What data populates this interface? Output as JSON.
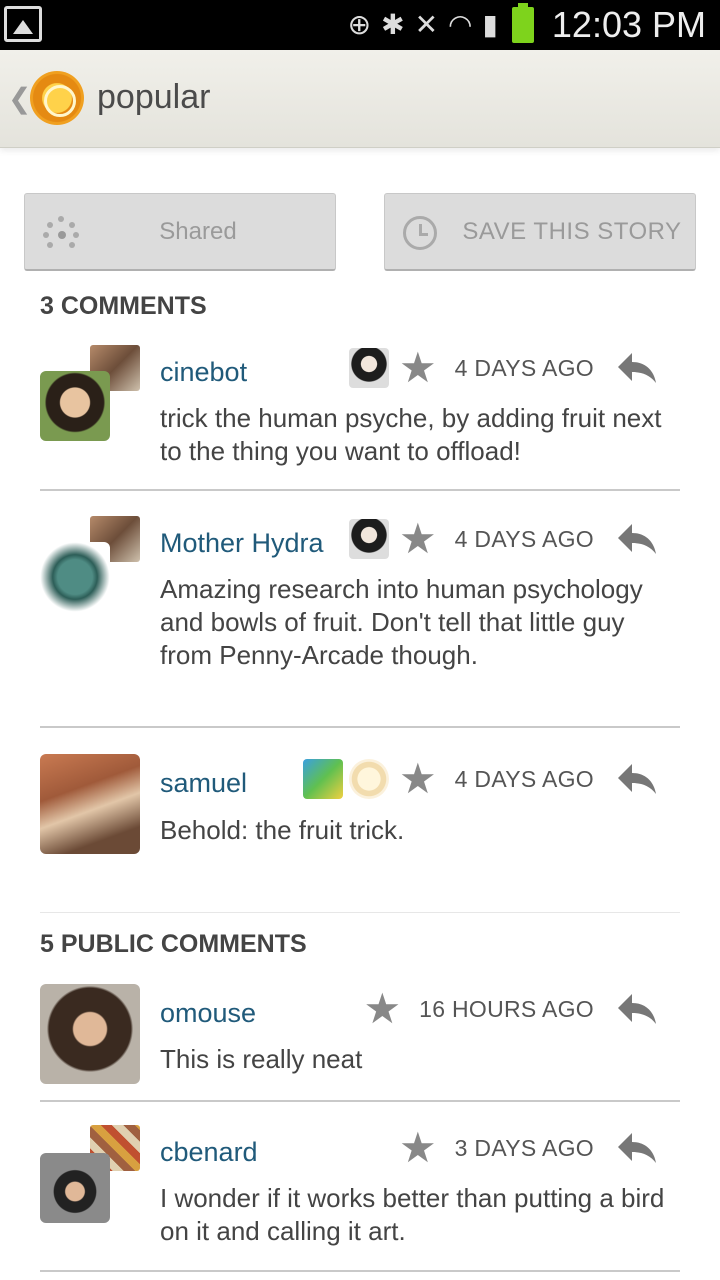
{
  "status_bar": {
    "time": "12:03 PM"
  },
  "action_bar": {
    "title": "popular"
  },
  "buttons": {
    "shared": "Shared",
    "save": "SAVE THIS STORY"
  },
  "shared_comments": {
    "header": "3 COMMENTS",
    "items": [
      {
        "user": "cinebot",
        "when": "4 DAYS AGO",
        "text": "trick the human psyche, by adding fruit next to the thing you want to offload!"
      },
      {
        "user": "Mother Hydra",
        "when": "4 DAYS AGO",
        "text": "Amazing research into human psychology and bowls of fruit. Don't tell that little guy from Penny-Arcade though."
      },
      {
        "user": "samuel",
        "when": "4 DAYS AGO",
        "text": "Behold: the fruit trick."
      }
    ]
  },
  "public_comments": {
    "header": "5 PUBLIC COMMENTS",
    "items": [
      {
        "user": "omouse",
        "when": "16 HOURS AGO",
        "text": "This is really neat"
      },
      {
        "user": "cbenard",
        "when": "3 DAYS AGO",
        "text": "I wonder if it works better than putting a bird on it and calling it art."
      }
    ]
  },
  "colors": {
    "username": "#205a7a",
    "accent_logo": "#e58a12",
    "battery": "#7ed31c"
  }
}
